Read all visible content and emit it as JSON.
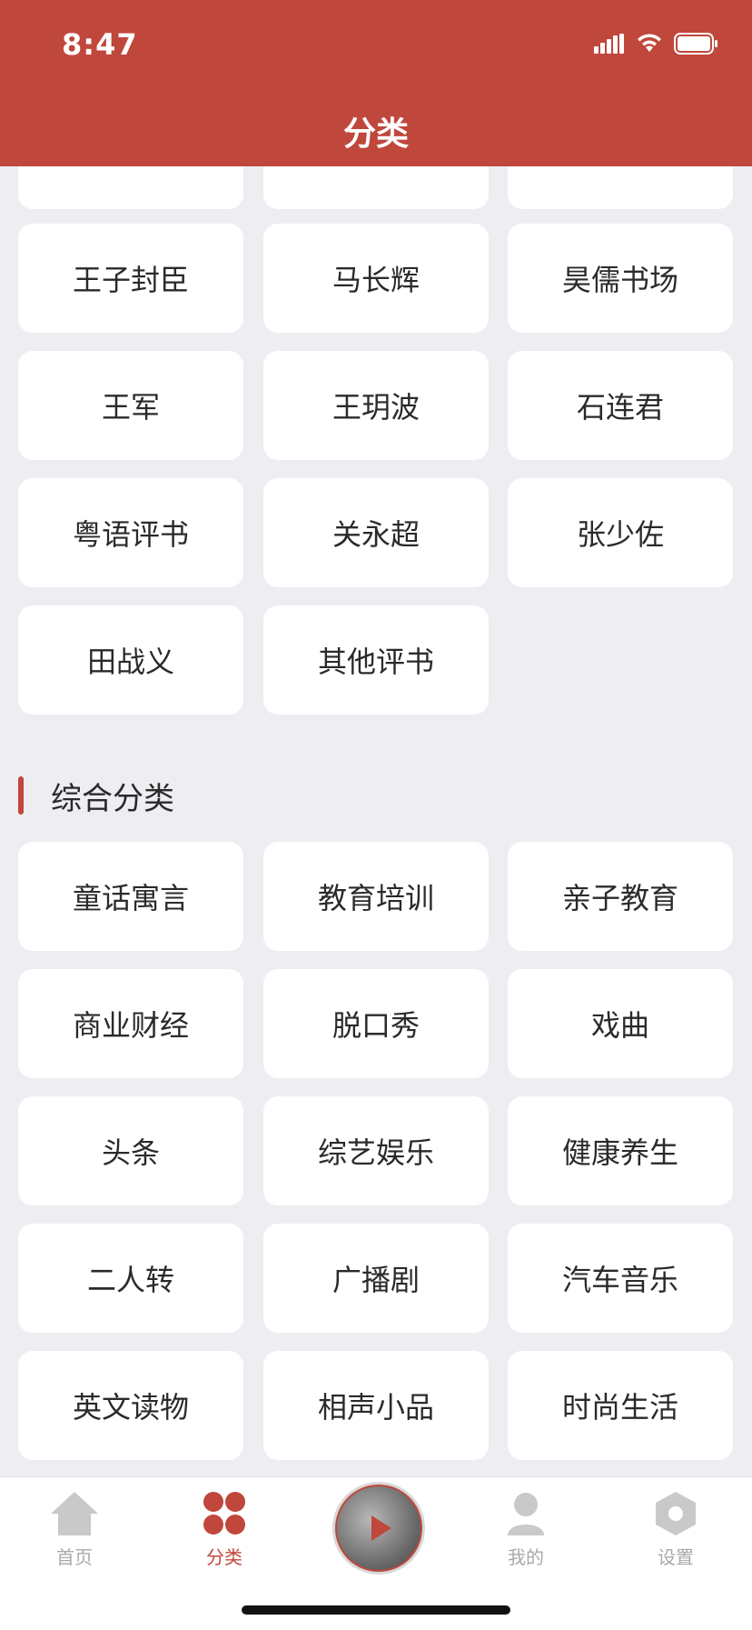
{
  "status_bar": {
    "time": "8:47"
  },
  "header": {
    "title": "分类"
  },
  "grid_top": {
    "items": [
      "王子封臣",
      "马长辉",
      "昊儒书场",
      "王军",
      "王玥波",
      "石连君",
      "粤语评书",
      "关永超",
      "张少佐",
      "田战义",
      "其他评书"
    ]
  },
  "section": {
    "title": "综合分类",
    "items": [
      "童话寓言",
      "教育培训",
      "亲子教育",
      "商业财经",
      "脱口秀",
      "戏曲",
      "头条",
      "综艺娱乐",
      "健康养生",
      "二人转",
      "广播剧",
      "汽车音乐",
      "英文读物",
      "相声小品",
      "时尚生活"
    ]
  },
  "tabs": [
    {
      "label": "首页",
      "icon": "home-icon"
    },
    {
      "label": "分类",
      "icon": "category-icon",
      "active": true
    },
    {
      "label": "",
      "icon": "player-disc-icon"
    },
    {
      "label": "我的",
      "icon": "user-icon"
    },
    {
      "label": "设置",
      "icon": "settings-icon"
    }
  ],
  "colors": {
    "accent": "#c0473b",
    "background": "#eeedf2",
    "card": "#ffffff",
    "inactive": "#a9a9a9"
  }
}
